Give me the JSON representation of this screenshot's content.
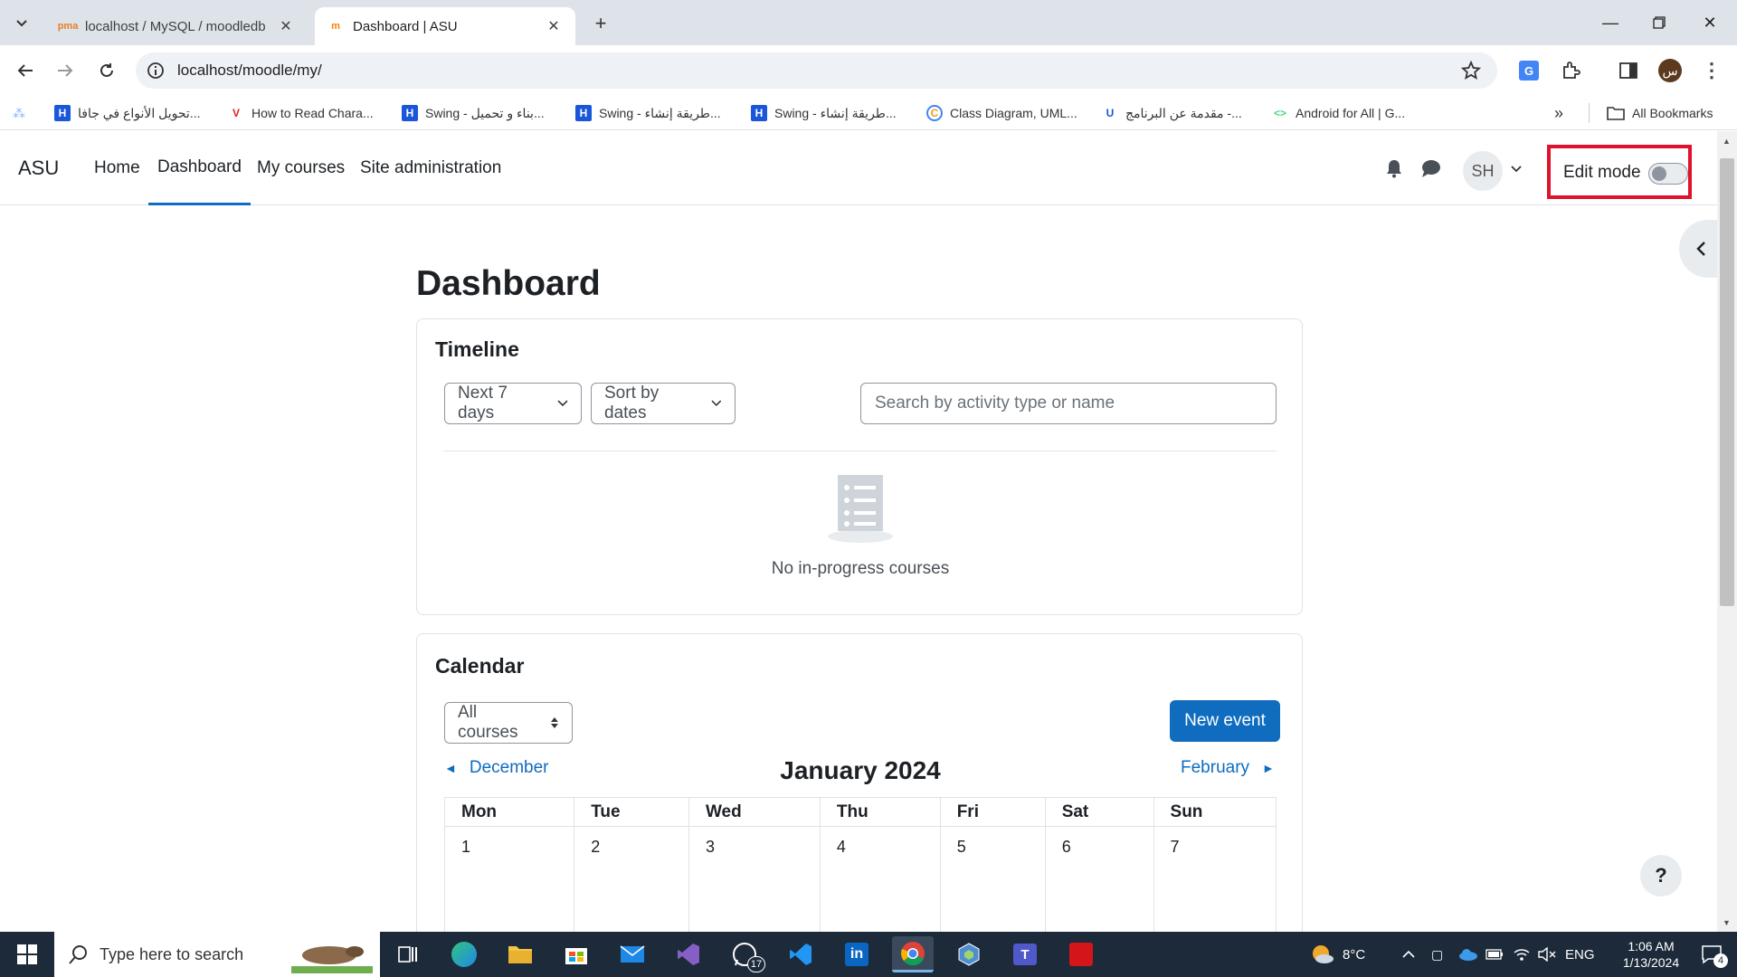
{
  "browser": {
    "tabs": [
      {
        "title": "localhost / MySQL / moodledb",
        "active": false
      },
      {
        "title": "Dashboard | ASU",
        "active": true
      }
    ],
    "url": "localhost/moodle/my/",
    "profile_initial": "س",
    "bookmarks": [
      {
        "label": "تحويل الأنواع في جافا...",
        "icon": "H"
      },
      {
        "label": "How to Read Chara...",
        "icon": "V"
      },
      {
        "label": "Swing - بناء و تحميل...",
        "icon": "H"
      },
      {
        "label": "Swing - طريقة إنشاء...",
        "icon": "H"
      },
      {
        "label": "Swing - طريقة إنشاء...",
        "icon": "H"
      },
      {
        "label": "Class Diagram, UML...",
        "icon": "C"
      },
      {
        "label": "مقدمة عن البرنامج -...",
        "icon": "U"
      },
      {
        "label": "Android for All | G...",
        "icon": "<>"
      }
    ],
    "all_bookmarks_label": "All Bookmarks"
  },
  "navbar": {
    "brand": "ASU",
    "links": [
      {
        "label": "Home",
        "active": false
      },
      {
        "label": "Dashboard",
        "active": true
      },
      {
        "label": "My courses",
        "active": false
      },
      {
        "label": "Site administration",
        "active": false
      }
    ],
    "avatar_initials": "SH",
    "edit_mode_label": "Edit mode",
    "edit_mode_on": false
  },
  "page": {
    "title": "Dashboard",
    "timeline": {
      "title": "Timeline",
      "filter_label": "Next 7 days",
      "sort_label": "Sort by dates",
      "search_placeholder": "Search by activity type or name",
      "empty_text": "No in-progress courses"
    },
    "calendar": {
      "title": "Calendar",
      "course_filter": "All courses",
      "new_event_label": "New event",
      "prev_month": "December",
      "current_month": "January 2024",
      "next_month": "February",
      "weekdays": [
        "Mon",
        "Tue",
        "Wed",
        "Thu",
        "Fri",
        "Sat",
        "Sun"
      ],
      "first_week": [
        "1",
        "2",
        "3",
        "4",
        "5",
        "6",
        "7"
      ]
    },
    "help_label": "?"
  },
  "taskbar": {
    "search_placeholder": "Type here to search",
    "whatsapp_badge": "17",
    "weather": "8°C",
    "language": "ENG",
    "time": "1:06 AM",
    "date": "1/13/2024",
    "notification_count": "4"
  },
  "colors": {
    "accent": "#0f6cbf",
    "highlight_box": "#e0112b"
  }
}
